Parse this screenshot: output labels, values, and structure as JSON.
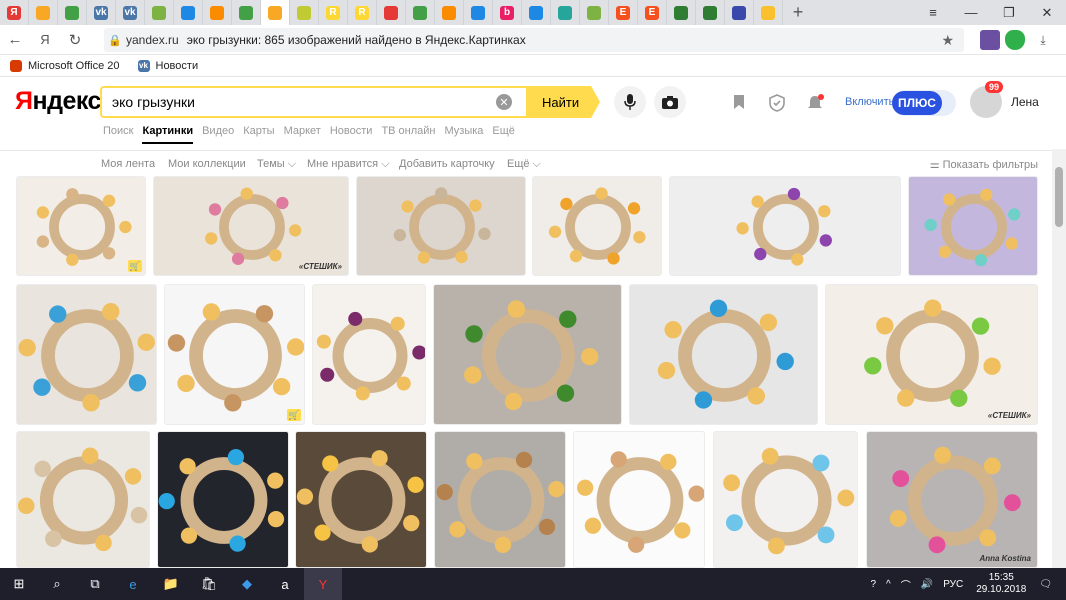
{
  "browser": {
    "tabs": [
      {
        "icon": "yandex-tab-icon",
        "color": "#e53935",
        "glyph": "Я",
        "active": false
      },
      {
        "icon": "image-tab-icon",
        "color": "#f9a825",
        "glyph": "",
        "active": false
      },
      {
        "icon": "clover-tab-icon",
        "color": "#43a047",
        "glyph": "",
        "active": false
      },
      {
        "icon": "vk-tab-icon",
        "color": "#4a76a8",
        "glyph": "vk",
        "active": false
      },
      {
        "icon": "vk-tab-icon",
        "color": "#4a76a8",
        "glyph": "vk",
        "active": false
      },
      {
        "icon": "gift-tab-icon",
        "color": "#7cb342",
        "glyph": "",
        "active": false
      },
      {
        "icon": "square-tab-icon",
        "color": "#1e88e5",
        "glyph": "",
        "active": false
      },
      {
        "icon": "colorful-tab-icon",
        "color": "#fb8c00",
        "glyph": "",
        "active": false
      },
      {
        "icon": "circle-tab-icon",
        "color": "#43a047",
        "glyph": "",
        "active": false
      },
      {
        "icon": "image-tab-icon",
        "color": "#f9a825",
        "glyph": "",
        "active": true
      },
      {
        "icon": "figure-tab-icon",
        "color": "#c0ca33",
        "glyph": "",
        "active": false
      },
      {
        "icon": "r-tab-icon",
        "color": "#fdd835",
        "glyph": "R",
        "active": false
      },
      {
        "icon": "r-tab-icon",
        "color": "#fdd835",
        "glyph": "R",
        "active": false
      },
      {
        "icon": "bird-tab-icon",
        "color": "#e53935",
        "glyph": "",
        "active": false
      },
      {
        "icon": "apple-tab-icon",
        "color": "#43a047",
        "glyph": "",
        "active": false
      },
      {
        "icon": "orange-tab-icon",
        "color": "#fb8c00",
        "glyph": "",
        "active": false
      },
      {
        "icon": "cart-tab-icon",
        "color": "#1e88e5",
        "glyph": "",
        "active": false
      },
      {
        "icon": "b-tab-icon",
        "color": "#e91e63",
        "glyph": "b",
        "active": false
      },
      {
        "icon": "cart-tab-icon",
        "color": "#1e88e5",
        "glyph": "",
        "active": false
      },
      {
        "icon": "dots-tab-icon",
        "color": "#26a69a",
        "glyph": "",
        "active": false
      },
      {
        "icon": "gift-tab-icon",
        "color": "#7cb342",
        "glyph": "",
        "active": false
      },
      {
        "icon": "e-tab-icon",
        "color": "#f4511e",
        "glyph": "E",
        "active": false
      },
      {
        "icon": "e-tab-icon",
        "color": "#f4511e",
        "glyph": "E",
        "active": false
      },
      {
        "icon": "green-tab-icon",
        "color": "#2e7d32",
        "glyph": "",
        "active": false
      },
      {
        "icon": "green-tab-icon",
        "color": "#2e7d32",
        "glyph": "",
        "active": false
      },
      {
        "icon": "target-tab-icon",
        "color": "#3949ab",
        "glyph": "",
        "active": false
      },
      {
        "icon": "sun-tab-icon",
        "color": "#fbc02d",
        "glyph": "",
        "active": false
      }
    ],
    "new_tab_glyph": "+",
    "window_controls": [
      "≡",
      "—",
      "❐",
      "✕"
    ],
    "nav": {
      "back": "←",
      "yandex": "Я",
      "reload": "↻"
    },
    "address": {
      "lock": "🔒",
      "host": "yandex.ru",
      "title": "эко грызунки: 865 изображений найдено в Яндекс.Картинках",
      "star": "★"
    },
    "download_glyph": "⤓",
    "bookmarks": [
      {
        "label": "Microsoft Office 20",
        "icon": "office-icon",
        "color": "#d83b01"
      },
      {
        "label": "Новости",
        "icon": "vk-icon",
        "color": "#4a76a8"
      }
    ]
  },
  "yandex": {
    "logo_first": "Я",
    "logo_rest": "ндекс",
    "query": "эко грызунки",
    "clear_glyph": "✕",
    "find_label": "Найти",
    "mic_glyph": "🎤",
    "camera_glyph": "📷",
    "enable_label": "Включить",
    "plus_label": "ПЛЮС",
    "badge": "99",
    "username": "Лена",
    "services": [
      "Поиск",
      "Картинки",
      "Видео",
      "Карты",
      "Маркет",
      "Новости",
      "ТВ онлайн",
      "Музыка",
      "Ещё"
    ],
    "active_service": "Картинки",
    "filters": [
      "Моя лента",
      "Мои коллекции",
      "Темы ⌵",
      "Мне нравится ⌵",
      "Добавить карточку",
      "Ещё ⌵"
    ],
    "show_filters": "⚌ Показать фильтры"
  },
  "images": [
    {
      "name": "wooden-bird-teether",
      "bg": "#f2ede6",
      "accent": "#d9b486",
      "cart": true,
      "wm": ""
    },
    {
      "name": "beaded-pacifier-chains",
      "bg": "#e9e3d9",
      "accent": "#e07ba0",
      "cart": false,
      "wm": "«СТЕШИК»"
    },
    {
      "name": "wooden-rings-teether",
      "bg": "#dcd6cf",
      "accent": "#c8b59a",
      "cart": false,
      "wm": ""
    },
    {
      "name": "crochet-bead-rattle",
      "bg": "#f0ece7",
      "accent": "#f0a32a",
      "cart": false,
      "wm": ""
    },
    {
      "name": "purple-bead-toys",
      "bg": "#efeeee",
      "accent": "#8e44ad",
      "cart": false,
      "wm": ""
    },
    {
      "name": "star-teether-lilac",
      "bg": "#c4b7dd",
      "accent": "#6fd0c8",
      "cart": false,
      "wm": ""
    },
    {
      "name": "bear-teether-beads",
      "bg": "#e9e4de",
      "accent": "#3aa0d8",
      "cart": false,
      "wm": ""
    },
    {
      "name": "wooden-bear-heart",
      "bg": "#f6f6f6",
      "accent": "#c79562",
      "cart": true,
      "wm": ""
    },
    {
      "name": "crochet-ring-teether",
      "bg": "#f5f1ec",
      "accent": "#7b2a6a",
      "cart": false,
      "wm": ""
    },
    {
      "name": "green-bead-ring-chain",
      "bg": "#b8b2ab",
      "accent": "#3f8a2d",
      "cart": false,
      "wm": ""
    },
    {
      "name": "striped-bead-rings",
      "bg": "#e6e6e6",
      "accent": "#2e9bd6",
      "cart": false,
      "wm": ""
    },
    {
      "name": "colorful-ring-set",
      "bg": "#f3efe8",
      "accent": "#7ac943",
      "cart": false,
      "wm": "«СТЕШИК»"
    },
    {
      "name": "wooden-car-teether",
      "bg": "#ebe7e1",
      "accent": "#d8c3a4",
      "cart": false,
      "wm": ""
    },
    {
      "name": "elephant-teether-dark",
      "bg": "#23252d",
      "accent": "#2aa6e0",
      "cart": false,
      "wm": ""
    },
    {
      "name": "bracelet-collection",
      "bg": "#5a4a3a",
      "accent": "#f6c344",
      "cart": false,
      "wm": ""
    },
    {
      "name": "wooden-butterfly-teether",
      "bg": "#b0ada8",
      "accent": "#b5824e",
      "cart": false,
      "wm": ""
    },
    {
      "name": "wooden-heart-teether",
      "bg": "#fbfbfb",
      "accent": "#d8a676",
      "cart": false,
      "wm": ""
    },
    {
      "name": "crochet-owls",
      "bg": "#f3f1ef",
      "accent": "#6ec5e9",
      "cart": false,
      "wm": ""
    },
    {
      "name": "pink-bead-heart-chain",
      "bg": "#b8b4b3",
      "accent": "#e3519b",
      "cart": false,
      "wm": "Anna Kostina"
    }
  ],
  "taskbar": {
    "items": [
      "⊞",
      "⌕",
      "⧉",
      "e",
      "📁",
      "🛍",
      "◆",
      "a",
      "Y"
    ],
    "tray": [
      "?",
      "^",
      "⌒",
      "🔊",
      "РУС"
    ],
    "time": "15:35",
    "date": "29.10.2018",
    "notif": "🗨"
  }
}
